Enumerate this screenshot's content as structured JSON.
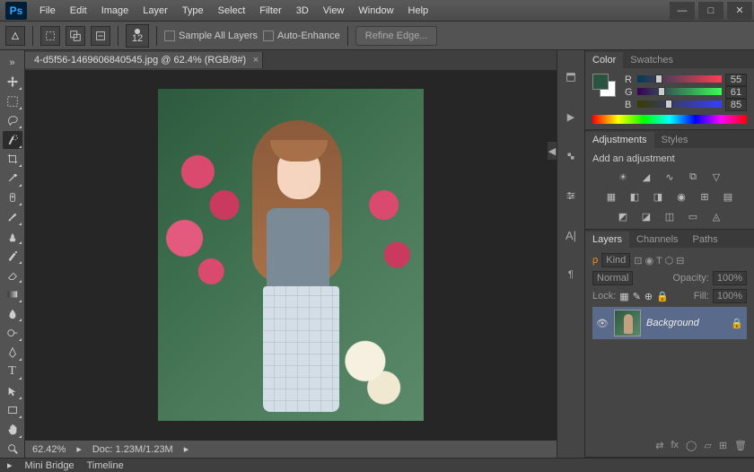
{
  "app": {
    "logo": "Ps"
  },
  "menu": [
    "File",
    "Edit",
    "Image",
    "Layer",
    "Type",
    "Select",
    "Filter",
    "3D",
    "View",
    "Window",
    "Help"
  ],
  "window_controls": {
    "min": "—",
    "max": "□",
    "close": "✕"
  },
  "options": {
    "brush_size": "12",
    "sample_all": "Sample All Layers",
    "auto_enhance": "Auto-Enhance",
    "refine_edge": "Refine Edge..."
  },
  "document": {
    "tab_label": "4-d5f56-1469606840545.jpg @ 62.4% (RGB/8#)"
  },
  "status": {
    "zoom": "62.42%",
    "doc": "Doc: 1.23M/1.23M"
  },
  "footer": {
    "mini_bridge": "Mini Bridge",
    "timeline": "Timeline"
  },
  "panels": {
    "color": {
      "tabs": [
        "Color",
        "Swatches"
      ],
      "channels": [
        {
          "label": "R",
          "value": "55",
          "pos": 21,
          "grad": "linear-gradient(90deg,#003d55,#ff3d55)"
        },
        {
          "label": "G",
          "value": "61",
          "pos": 24,
          "grad": "linear-gradient(90deg,#370055,#37ff55)"
        },
        {
          "label": "B",
          "value": "85",
          "pos": 33,
          "grad": "linear-gradient(90deg,#373d00,#373dff)"
        }
      ]
    },
    "adjustments": {
      "tabs": [
        "Adjustments",
        "Styles"
      ],
      "title": "Add an adjustment"
    },
    "layers": {
      "tabs": [
        "Layers",
        "Channels",
        "Paths"
      ],
      "kind": "Kind",
      "blend": "Normal",
      "opacity_label": "Opacity:",
      "opacity_value": "100%",
      "lock_label": "Lock:",
      "fill_label": "Fill:",
      "fill_value": "100%",
      "items": [
        {
          "name": "Background",
          "locked": true
        }
      ]
    }
  }
}
